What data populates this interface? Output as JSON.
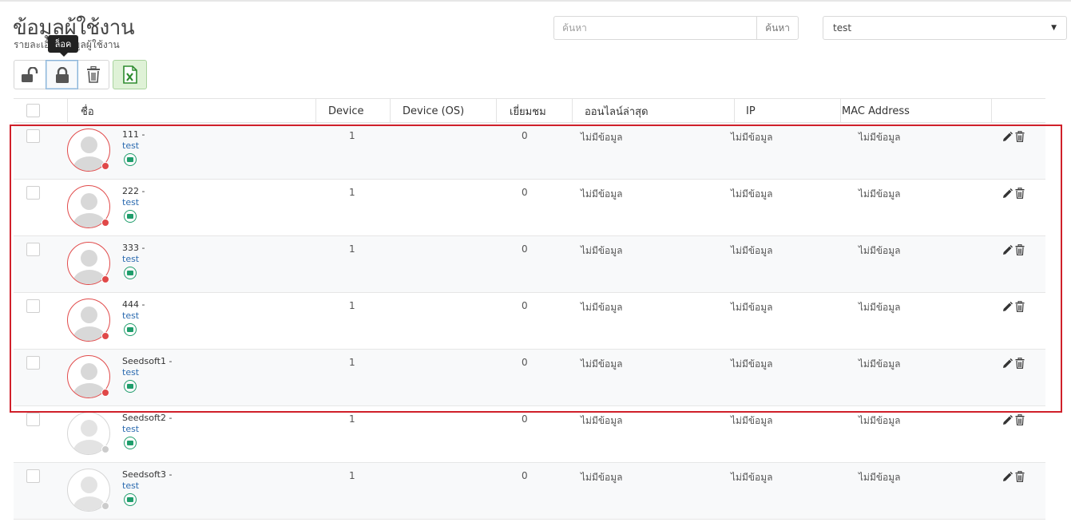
{
  "page": {
    "title": "ข้อมูลผู้ใช้งาน",
    "subtitle": "รายละเอียดข้อมูลผู้ใช้งาน"
  },
  "search": {
    "placeholder": "ค้นหา",
    "button_label": "ค้นหา"
  },
  "filter": {
    "selected": "test"
  },
  "toolbar": {
    "unlock_icon": "unlock-icon",
    "lock_icon": "lock-icon",
    "delete_icon": "trash-icon",
    "excel_icon": "excel-icon",
    "tooltip": "ล็อค"
  },
  "table": {
    "headers": [
      "ชื่อ",
      "Device",
      "Device (OS)",
      "เยี่ยมชม",
      "ออนไลน์ล่าสุด",
      "IP",
      "MAC Address"
    ],
    "rows": [
      {
        "name": "111 -",
        "type": "test",
        "device": "1",
        "os": "",
        "visits": "0",
        "last_online": "ไม่มีข้อมูล",
        "ip": "ไม่มีข้อมูล",
        "mac": "ไม่มีข้อมูล",
        "online": true
      },
      {
        "name": "222 -",
        "type": "test",
        "device": "1",
        "os": "",
        "visits": "0",
        "last_online": "ไม่มีข้อมูล",
        "ip": "ไม่มีข้อมูล",
        "mac": "ไม่มีข้อมูล",
        "online": true
      },
      {
        "name": "333 -",
        "type": "test",
        "device": "1",
        "os": "",
        "visits": "0",
        "last_online": "ไม่มีข้อมูล",
        "ip": "ไม่มีข้อมูล",
        "mac": "ไม่มีข้อมูล",
        "online": true
      },
      {
        "name": "444 -",
        "type": "test",
        "device": "1",
        "os": "",
        "visits": "0",
        "last_online": "ไม่มีข้อมูล",
        "ip": "ไม่มีข้อมูล",
        "mac": "ไม่มีข้อมูล",
        "online": true
      },
      {
        "name": "Seedsoft1 -",
        "type": "test",
        "device": "1",
        "os": "",
        "visits": "0",
        "last_online": "ไม่มีข้อมูล",
        "ip": "ไม่มีข้อมูล",
        "mac": "ไม่มีข้อมูล",
        "online": true
      },
      {
        "name": "Seedsoft2 -",
        "type": "test",
        "device": "1",
        "os": "",
        "visits": "0",
        "last_online": "ไม่มีข้อมูล",
        "ip": "ไม่มีข้อมูล",
        "mac": "ไม่มีข้อมูล",
        "online": false
      },
      {
        "name": "Seedsoft3 -",
        "type": "test",
        "device": "1",
        "os": "",
        "visits": "0",
        "last_online": "ไม่มีข้อมูล",
        "ip": "ไม่มีข้อมูล",
        "mac": "ไม่มีข้อมูล",
        "online": false
      }
    ]
  },
  "colors": {
    "online_dot": "#e04848",
    "offline_dot": "#cccccc",
    "highlight": "#d0202a",
    "mail_icon": "#1f9d6b"
  }
}
